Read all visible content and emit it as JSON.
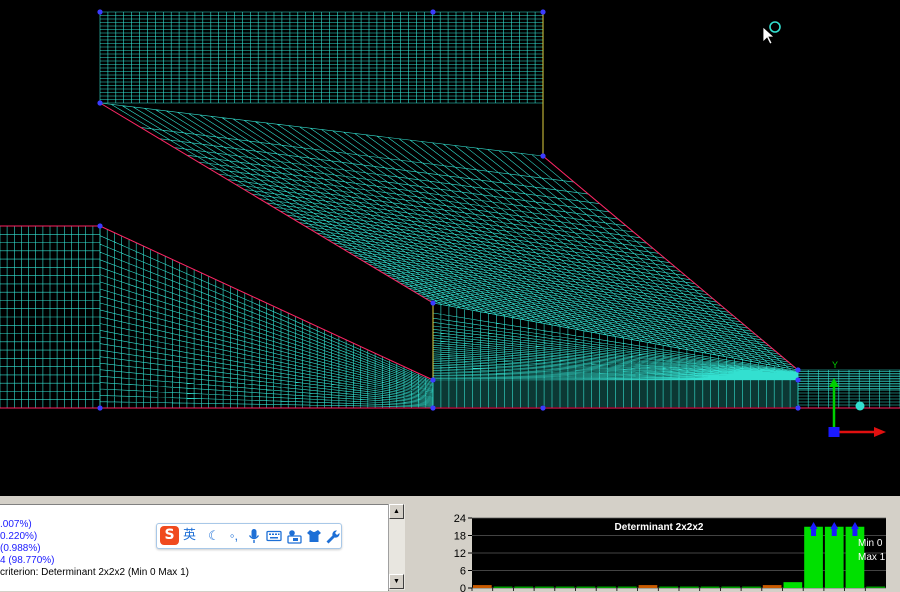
{
  "viewport": {
    "background": "#000000",
    "mesh_color": "#33e0d0",
    "edge_color": "#ff2060",
    "vertex_color": "#3b3bff",
    "axis_y_label": "Y"
  },
  "messages": {
    "lines": [
      {
        "text": ".007%)",
        "color": "blue"
      },
      {
        "text": "0.220%)",
        "color": "blue"
      },
      {
        "text": " (0.988%)",
        "color": "blue"
      },
      {
        "text": "4 (98.770%)",
        "color": "blue"
      },
      {
        "text": " criterion: Determinant 2x2x2 (Min 0 Max 1)",
        "color": "black"
      }
    ]
  },
  "ime_toolbar": {
    "logo": "S",
    "language": "英",
    "icons": [
      "moon-icon",
      "punctuation-icon",
      "microphone-icon",
      "keyboard-icon",
      "toolbox-icon",
      "skin-icon",
      "wrench-icon"
    ]
  },
  "histogram": {
    "title": "Determinant 2x2x2",
    "min_label": "Min 0",
    "max_label": "Max 1"
  },
  "chart_data": {
    "type": "bar",
    "title": "Determinant 2x2x2",
    "x_range": [
      0,
      1
    ],
    "ylim": [
      0,
      24
    ],
    "yticks": [
      "24",
      "18",
      "12",
      "6",
      "0"
    ],
    "ytick_values": [
      24,
      18,
      12,
      6,
      0
    ],
    "bins": 20,
    "values": [
      1,
      0,
      0,
      0,
      0,
      0,
      0,
      0,
      1,
      0,
      0,
      0,
      0,
      0,
      1,
      2,
      21,
      21,
      21,
      0
    ],
    "bar_color": "#00e000",
    "grid": true,
    "annotations": [
      "Min 0",
      "Max 1"
    ]
  }
}
